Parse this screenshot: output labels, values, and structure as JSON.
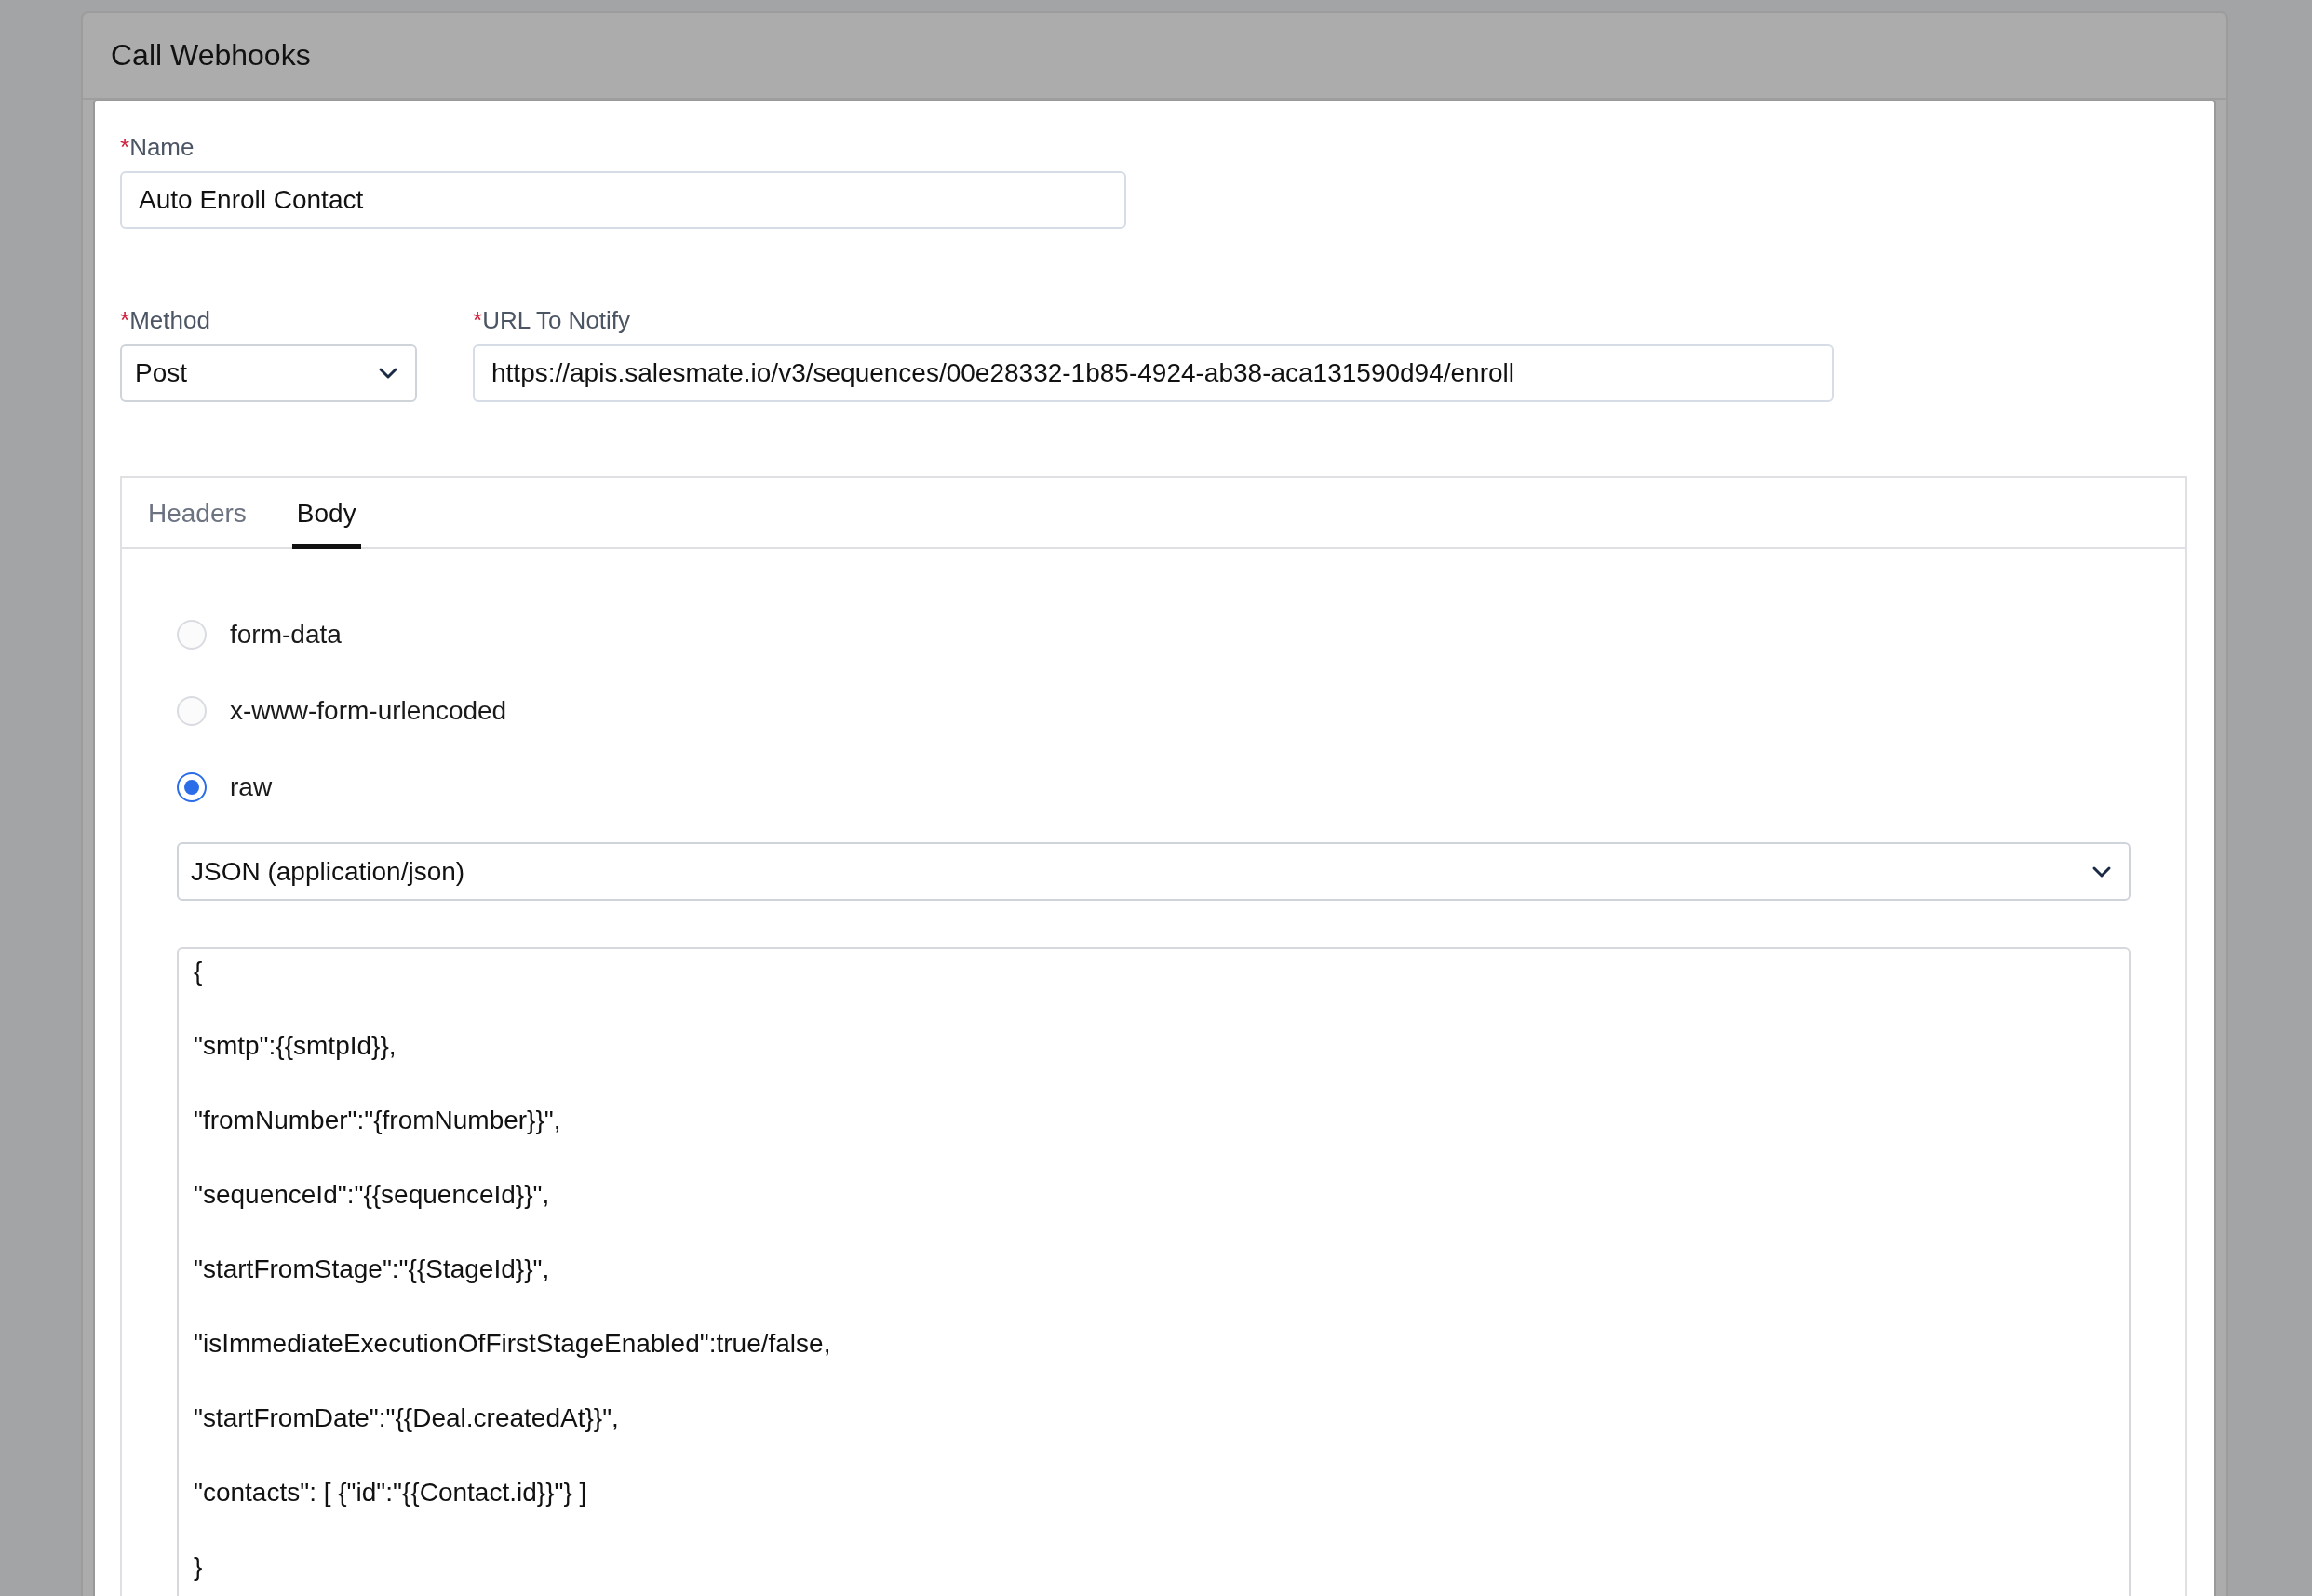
{
  "panel": {
    "title": "Call Webhooks"
  },
  "name_field": {
    "required_mark": "*",
    "label": "Name",
    "value": "Auto Enroll Contact"
  },
  "method_field": {
    "required_mark": "*",
    "label": "Method",
    "value": "Post"
  },
  "url_field": {
    "required_mark": "*",
    "label": "URL To Notify",
    "value": "https://apis.salesmate.io/v3/sequences/00e28332-1b85-4924-ab38-aca131590d94/enroll"
  },
  "tabs": [
    {
      "label": "Headers",
      "selected": false
    },
    {
      "label": "Body",
      "selected": true
    }
  ],
  "body_types": [
    {
      "label": "form-data",
      "selected": false
    },
    {
      "label": "x-www-form-urlencoded",
      "selected": false
    },
    {
      "label": "raw",
      "selected": true
    }
  ],
  "format_select": {
    "value": "JSON (application/json)"
  },
  "body_lines": [
    "{",
    "\"smtp\":{{smtpId}},",
    "\"fromNumber\":\"{fromNumber}}\",",
    "\"sequenceId\":\"{{sequenceId}}\",",
    "\"startFromStage\":\"{{StageId}}\",",
    "\"isImmediateExecutionOfFirstStageEnabled\":true/false,",
    "\"startFromDate\":\"{{Deal.createdAt}}\",",
    "\"contacts\": [ {\"id\":\"{{Contact.id}}\"} ]",
    "}"
  ]
}
